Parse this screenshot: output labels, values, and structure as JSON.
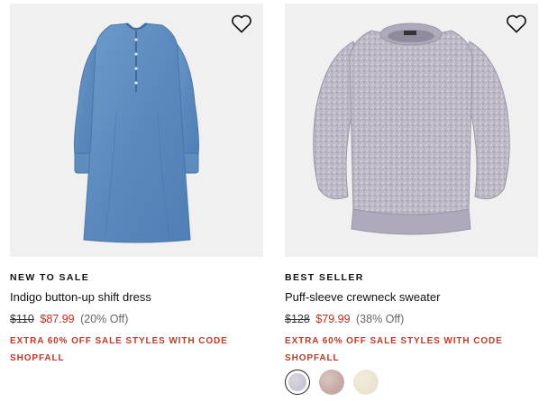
{
  "products": [
    {
      "badge": "NEW TO SALE",
      "name": "Indigo button-up shift dress",
      "original_price": "$110",
      "sale_price": "$87.99",
      "discount": "(20% Off)",
      "promo": "EXTRA 60% OFF SALE STYLES WITH CODE SHOPFALL",
      "image": "denim-dress"
    },
    {
      "badge": "BEST SELLER",
      "name": "Puff-sleeve crewneck sweater",
      "original_price": "$128",
      "sale_price": "$79.99",
      "discount": "(38% Off)",
      "promo": "EXTRA 60% OFF SALE STYLES WITH CODE SHOPFALL",
      "image": "heather-sweater",
      "swatches": [
        {
          "color": "#c9c5d3",
          "selected": true
        },
        {
          "color": "#c7a9a4",
          "selected": false
        },
        {
          "color": "#ece3d0",
          "selected": false
        }
      ]
    }
  ],
  "icons": {
    "wishlist": "heart-outline-icon"
  },
  "colors": {
    "sale_red": "#c02b20",
    "image_bg": "#f0f0f0"
  }
}
